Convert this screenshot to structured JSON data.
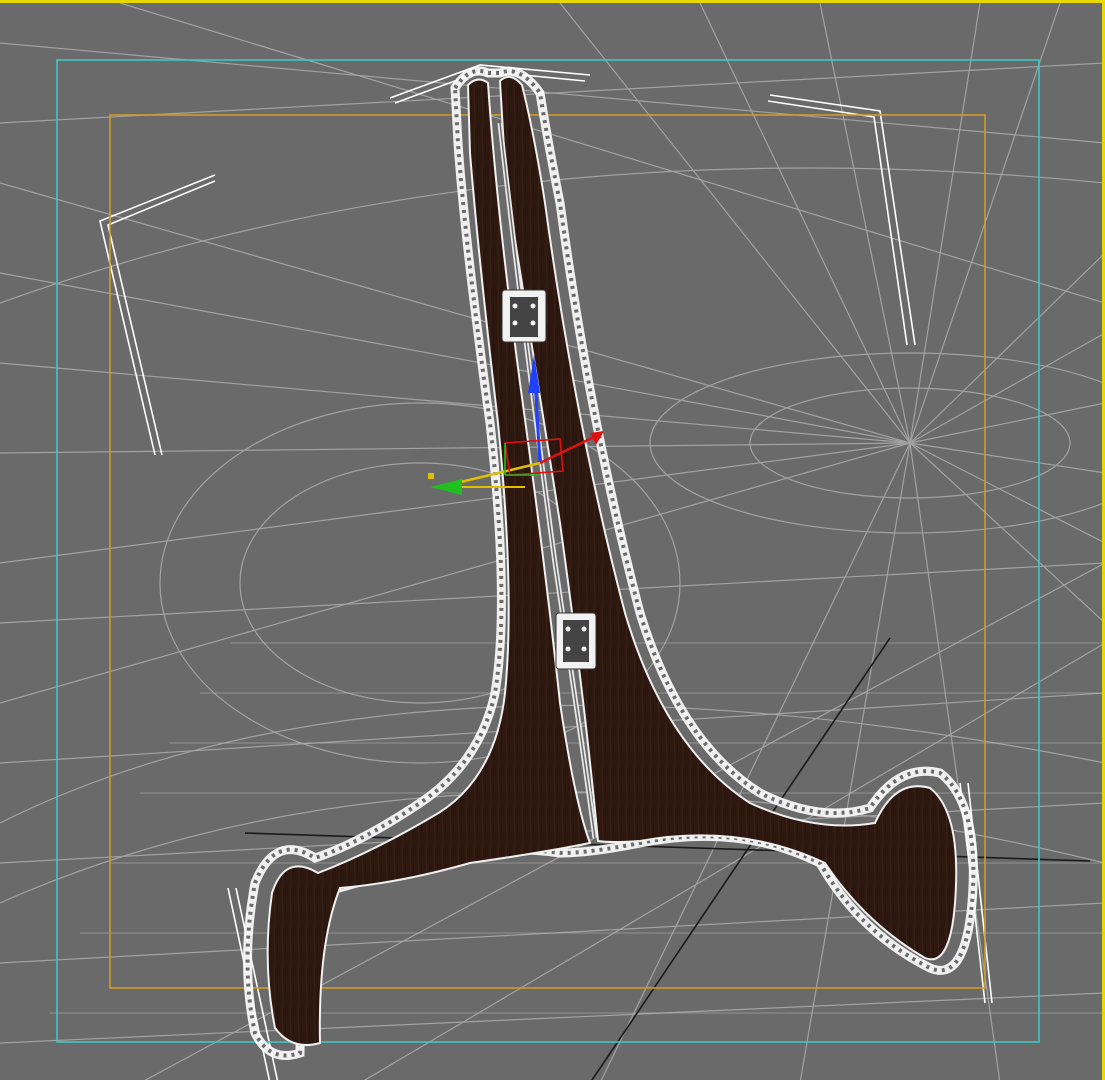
{
  "viewport": {
    "active_border_color": "#e8d800",
    "background_color": "#6a6a6a",
    "grid_color": "#d8d8d8",
    "safe_frame_outer_color": "#3fc6c6",
    "safe_frame_inner_color": "#d49a2a"
  },
  "object": {
    "fill_color": "#2d1810",
    "wireframe_color": "#ffffff",
    "hinges": [
      "hinge-top",
      "hinge-bottom"
    ]
  },
  "gizmo": {
    "icon": "move-transform-gizmo-icon",
    "axis_colors": {
      "x": "#e01010",
      "y": "#20c020",
      "z": "#2040ff"
    }
  }
}
